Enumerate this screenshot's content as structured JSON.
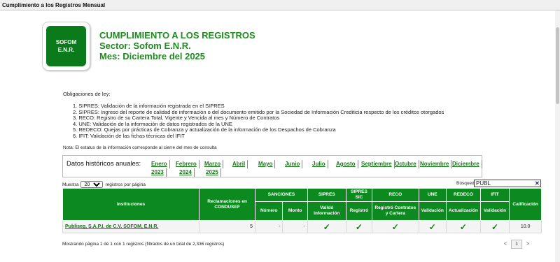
{
  "window": {
    "title": "Cumplimiento a los Registros Mensual"
  },
  "logo": {
    "line1": "SOFOM",
    "line2": "E.N.R."
  },
  "header": {
    "title": "CUMPLIMIENTO A LOS REGISTROS",
    "sector": "Sector: Sofom E.N.R.",
    "mes": "Mes: Diciembre del 2025"
  },
  "obligaciones": {
    "heading": "Obligaciones de ley:",
    "items": [
      "1. SIPRES: Validación de la información registrada en el SIPRES",
      "2. SIPRES: Ingreso del reporte de calidad de información o del documento emitido por la Sociedad de Información Crediticia respecto de los créditos otorgados",
      "3. RECO: Registro de su Cartera Total, Vigente y Vencida al mes y Número de Contratos",
      "4. UNE: Validación de la información de datos registrados de la UNE",
      "5. REDECO: Quejas por prácticas de Cobranza y actualización de la información de los Despachos de Cobranza",
      "6. IFIT: Validación de las fichas técnicas del IFIT"
    ],
    "nota": "Nota: El estatus de la información corresponde al cierre del mes de consulta"
  },
  "historicos": {
    "label": "Datos históricos anuales:",
    "months": [
      "Enero",
      "Febrero",
      "Marzo",
      "Abril",
      "Mayo",
      "Junio",
      "Julio",
      "Agosto",
      "Septiembre",
      "Octubre",
      "Noviembre",
      "Diciembre"
    ],
    "years": [
      "2023",
      "2024",
      "2025"
    ]
  },
  "controls": {
    "muestra_label": "Muestra",
    "page_size": "20",
    "registros_label": "registros por página",
    "busqueda_label": "Búsqueda:",
    "busqueda_value": "PUBL",
    "clear": "✕"
  },
  "table": {
    "headers": {
      "instituciones": "Instituciones",
      "reclamaciones": "Reclamaciones en CONDUSEF",
      "sanciones": "SANCIONES",
      "numero": "Número",
      "monto": "Monto",
      "sipres": "SIPRES",
      "valido": "Validó Información",
      "sipres_sic": "SIPRES SIC",
      "registro": "Registró",
      "reco": "RECO",
      "reco_sub": "Registró Contratos y Cartera",
      "une": "UNE",
      "une_sub": "Validación",
      "redeco": "REDECO",
      "redeco_sub": "Actualización",
      "ifit": "IFIT",
      "ifit_sub": "Validación",
      "calificacion": "Calificación"
    },
    "rows": [
      {
        "institucion": "Publiseg, S.A.P.I. de C.V. SOFOM, E.N.R.",
        "reclamaciones": "5",
        "numero": "-",
        "monto": "-",
        "check": "✓",
        "calificacion": "10.0"
      }
    ]
  },
  "footer": {
    "info": "Mostrando página 1 de 1 con 1 registros (filtrados de un total de 2,336 registros)",
    "prev": "<",
    "page": "1",
    "next": ">"
  }
}
